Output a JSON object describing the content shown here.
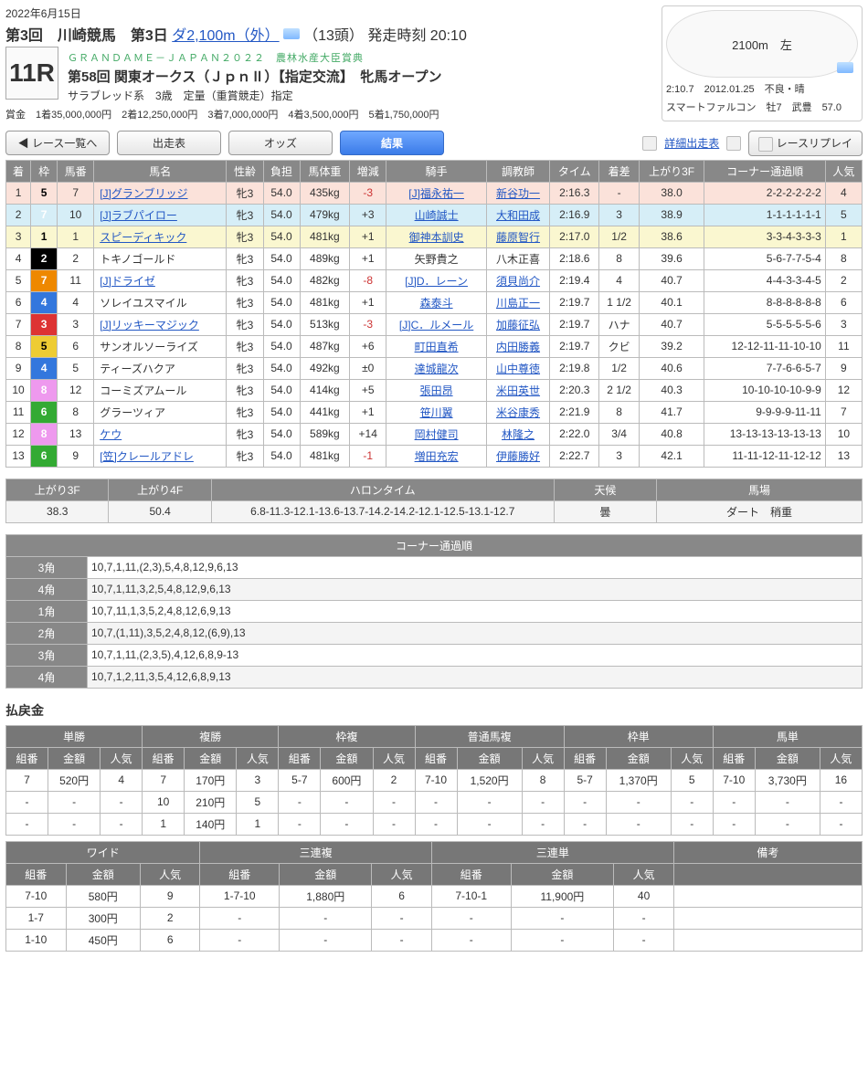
{
  "header": {
    "date": "2022年6月15日",
    "meeting": "第3回　川崎競馬　第3日",
    "course_link": "ダ2,100m（外）",
    "heads": "（13頭）",
    "start_label": "発走時刻 20:10",
    "gj": "ＧＲＡＮＤＡＭＥ－ＪＡＰＡＮ２０２２　農林水産大臣賞典",
    "title": "第58回 関東オークス（ＪｐｎⅡ）【指定交流】　牝馬オープン",
    "sub": "サラブレッド系　3歳　定量（重賞競走）指定",
    "prizes": "賞金　1着35,000,000円　2着12,250,000円　3着7,000,000円　4着3,500,000円　5着1,750,000円",
    "race_no": "11R"
  },
  "record": {
    "track_main": "2100m　左",
    "line1": "2:10.7　2012.01.25　不良・晴",
    "line2": "スマートファルコン　牡7　武豊　57.0"
  },
  "buttons": {
    "back": "レース一覧へ",
    "entries": "出走表",
    "odds": "オッズ",
    "result": "結果",
    "detail": "詳細出走表",
    "replay": "レースリプレイ"
  },
  "cols": [
    "着",
    "枠",
    "馬番",
    "馬名",
    "性齢",
    "負担",
    "馬体重",
    "増減",
    "騎手",
    "調教師",
    "タイム",
    "着差",
    "上がり3F",
    "コーナー通過順",
    "人気"
  ],
  "rows": [
    {
      "p": 1,
      "f": 5,
      "n": 7,
      "name": "[J]グランブリッジ",
      "sa": "牝3",
      "w": "54.0",
      "bw": "435kg",
      "d": "-3",
      "jk": "[J]福永祐一",
      "tr": "新谷功一",
      "time": "2:16.3",
      "mg": "-",
      "l3f": "38.0",
      "cn": "2-2-2-2-2-2",
      "pop": 4,
      "nl": true,
      "jl": true,
      "tl": true
    },
    {
      "p": 2,
      "f": 7,
      "n": 10,
      "name": "[J]ラブパイロー",
      "sa": "牝3",
      "w": "54.0",
      "bw": "479kg",
      "d": "+3",
      "jk": "山崎誠士",
      "tr": "大和田成",
      "time": "2:16.9",
      "mg": "3",
      "l3f": "38.9",
      "cn": "1-1-1-1-1-1",
      "pop": 5,
      "nl": true,
      "jl": true,
      "tl": true
    },
    {
      "p": 3,
      "f": 1,
      "n": 1,
      "name": "スピーディキック",
      "sa": "牝3",
      "w": "54.0",
      "bw": "481kg",
      "d": "+1",
      "jk": "御神本訓史",
      "tr": "藤原智行",
      "time": "2:17.0",
      "mg": "1/2",
      "l3f": "38.6",
      "cn": "3-3-4-3-3-3",
      "pop": 1,
      "nl": true,
      "jl": true,
      "tl": true
    },
    {
      "p": 4,
      "f": 2,
      "n": 2,
      "name": "トキノゴールド",
      "sa": "牝3",
      "w": "54.0",
      "bw": "489kg",
      "d": "+1",
      "jk": "矢野貴之",
      "tr": "八木正喜",
      "time": "2:18.6",
      "mg": "8",
      "l3f": "39.6",
      "cn": "5-6-7-7-5-4",
      "pop": 8
    },
    {
      "p": 5,
      "f": 7,
      "n": 11,
      "name": "[J]ドライゼ",
      "sa": "牝3",
      "w": "54.0",
      "bw": "482kg",
      "d": "-8",
      "jk": "[J]D．レーン",
      "tr": "須貝尚介",
      "time": "2:19.4",
      "mg": "4",
      "l3f": "40.7",
      "cn": "4-4-3-3-4-5",
      "pop": 2,
      "nl": true,
      "jl": true,
      "tl": true
    },
    {
      "p": 6,
      "f": 4,
      "n": 4,
      "name": "ソレイユスマイル",
      "sa": "牝3",
      "w": "54.0",
      "bw": "481kg",
      "d": "+1",
      "jk": "森泰斗",
      "tr": "川島正一",
      "time": "2:19.7",
      "mg": "1 1/2",
      "l3f": "40.1",
      "cn": "8-8-8-8-8-8",
      "pop": 6,
      "jl": true,
      "tl": true
    },
    {
      "p": 7,
      "f": 3,
      "n": 3,
      "name": "[J]リッキーマジック",
      "sa": "牝3",
      "w": "54.0",
      "bw": "513kg",
      "d": "-3",
      "jk": "[J]C．ルメール",
      "tr": "加藤征弘",
      "time": "2:19.7",
      "mg": "ハナ",
      "l3f": "40.7",
      "cn": "5-5-5-5-5-6",
      "pop": 3,
      "nl": true,
      "jl": true,
      "tl": true
    },
    {
      "p": 8,
      "f": 5,
      "n": 6,
      "name": "サンオルソーライズ",
      "sa": "牝3",
      "w": "54.0",
      "bw": "487kg",
      "d": "+6",
      "jk": "町田直希",
      "tr": "内田勝義",
      "time": "2:19.7",
      "mg": "クビ",
      "l3f": "39.2",
      "cn": "12-12-11-11-10-10",
      "pop": 11,
      "jl": true,
      "tl": true
    },
    {
      "p": 9,
      "f": 4,
      "n": 5,
      "name": "ティーズハクア",
      "sa": "牝3",
      "w": "54.0",
      "bw": "492kg",
      "d": "±0",
      "jk": "達城龍次",
      "tr": "山中尊徳",
      "time": "2:19.8",
      "mg": "1/2",
      "l3f": "40.6",
      "cn": "7-7-6-6-5-7",
      "pop": 9,
      "jl": true,
      "tl": true
    },
    {
      "p": 10,
      "f": 8,
      "n": 12,
      "name": "コーミズアムール",
      "sa": "牝3",
      "w": "54.0",
      "bw": "414kg",
      "d": "+5",
      "jk": "張田昂",
      "tr": "米田英世",
      "time": "2:20.3",
      "mg": "2 1/2",
      "l3f": "40.3",
      "cn": "10-10-10-10-9-9",
      "pop": 12,
      "jl": true,
      "tl": true
    },
    {
      "p": 11,
      "f": 6,
      "n": 8,
      "name": "グラーツィア",
      "sa": "牝3",
      "w": "54.0",
      "bw": "441kg",
      "d": "+1",
      "jk": "笹川翼",
      "tr": "米谷康秀",
      "time": "2:21.9",
      "mg": "8",
      "l3f": "41.7",
      "cn": "9-9-9-9-11-11",
      "pop": 7,
      "jl": true,
      "tl": true
    },
    {
      "p": 12,
      "f": 8,
      "n": 13,
      "name": "ケウ",
      "sa": "牝3",
      "w": "54.0",
      "bw": "589kg",
      "d": "+14",
      "jk": "岡村健司",
      "tr": "林隆之",
      "time": "2:22.0",
      "mg": "3/4",
      "l3f": "40.8",
      "cn": "13-13-13-13-13-13",
      "pop": 10,
      "nl": true,
      "jl": true,
      "tl": true
    },
    {
      "p": 13,
      "f": 6,
      "n": 9,
      "name": "[笠]クレールアドレ",
      "sa": "牝3",
      "w": "54.0",
      "bw": "481kg",
      "d": "-1",
      "jk": "増田充宏",
      "tr": "伊藤勝好",
      "time": "2:22.7",
      "mg": "3",
      "l3f": "42.1",
      "cn": "11-11-12-11-12-12",
      "pop": 13,
      "nl": true,
      "jl": true,
      "tl": true
    }
  ],
  "lap": {
    "h": [
      "上がり3F",
      "上がり4F",
      "ハロンタイム",
      "天候",
      "馬場"
    ],
    "v": [
      "38.3",
      "50.4",
      "6.8-11.3-12.1-13.6-13.7-14.2-14.2-12.1-12.5-13.1-12.7",
      "曇",
      "ダート　稍重"
    ]
  },
  "corner": {
    "title": "コーナー通過順",
    "rows": [
      [
        "3角",
        "10,7,1,11,(2,3),5,4,8,12,9,6,13"
      ],
      [
        "4角",
        "10,7,1,11,3,2,5,4,8,12,9,6,13"
      ],
      [
        "1角",
        "10,7,11,1,3,5,2,4,8,12,6,9,13"
      ],
      [
        "2角",
        "10,7,(1,11),3,5,2,4,8,12,(6,9),13"
      ],
      [
        "3角",
        "10,7,1,11,(2,3,5),4,12,6,8,9-13"
      ],
      [
        "4角",
        "10,7,1,2,11,3,5,4,12,6,8,9,13"
      ]
    ]
  },
  "payout_title": "払戻金",
  "pay_headers": {
    "top": [
      "単勝",
      "複勝",
      "枠複",
      "普通馬複",
      "枠単",
      "馬単"
    ],
    "sub": [
      "組番",
      "金額",
      "人気"
    ],
    "bottom": [
      "ワイド",
      "三連複",
      "三連単",
      "備考"
    ]
  },
  "pay_top": [
    [
      "7",
      "520円",
      "4",
      "7",
      "170円",
      "3",
      "5-7",
      "600円",
      "2",
      "7-10",
      "1,520円",
      "8",
      "5-7",
      "1,370円",
      "5",
      "7-10",
      "3,730円",
      "16"
    ],
    [
      "-",
      "-",
      "-",
      "10",
      "210円",
      "5",
      "-",
      "-",
      "-",
      "-",
      "-",
      "-",
      "-",
      "-",
      "-",
      "-",
      "-",
      "-"
    ],
    [
      "-",
      "-",
      "-",
      "1",
      "140円",
      "1",
      "-",
      "-",
      "-",
      "-",
      "-",
      "-",
      "-",
      "-",
      "-",
      "-",
      "-",
      "-"
    ]
  ],
  "pay_bottom": [
    [
      "7-10",
      "580円",
      "9",
      "1-7-10",
      "1,880円",
      "6",
      "7-10-1",
      "11,900円",
      "40",
      ""
    ],
    [
      "1-7",
      "300円",
      "2",
      "-",
      "-",
      "-",
      "-",
      "-",
      "-",
      ""
    ],
    [
      "1-10",
      "450円",
      "6",
      "-",
      "-",
      "-",
      "-",
      "-",
      "-",
      ""
    ]
  ]
}
